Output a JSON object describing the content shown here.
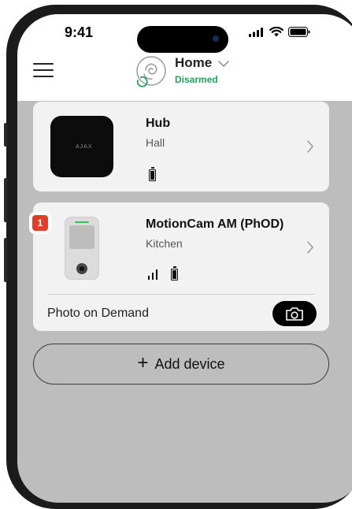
{
  "status_bar": {
    "time": "9:41"
  },
  "header": {
    "title": "Home",
    "status": "Disarmed"
  },
  "devices": [
    {
      "name": "Hub",
      "room": "Hall",
      "device_brand": "AJAX"
    },
    {
      "name": "MotionCam AM (PhOD)",
      "room": "Kitchen",
      "alert_count": "1",
      "action_label": "Photo on Demand"
    }
  ],
  "add_device": {
    "label": "Add device"
  },
  "colors": {
    "armed_status": "#25a05a",
    "alert_badge": "#e23d2b",
    "card": "#f2f2f2",
    "screen_bg": "#bdbdbd"
  },
  "icons": [
    "menu-icon",
    "hub-logo-icon",
    "chevron-down-icon",
    "chevron-right-icon",
    "battery-icon",
    "signal-icon",
    "camera-icon",
    "plus-icon",
    "wifi-icon",
    "cellular-icon"
  ]
}
